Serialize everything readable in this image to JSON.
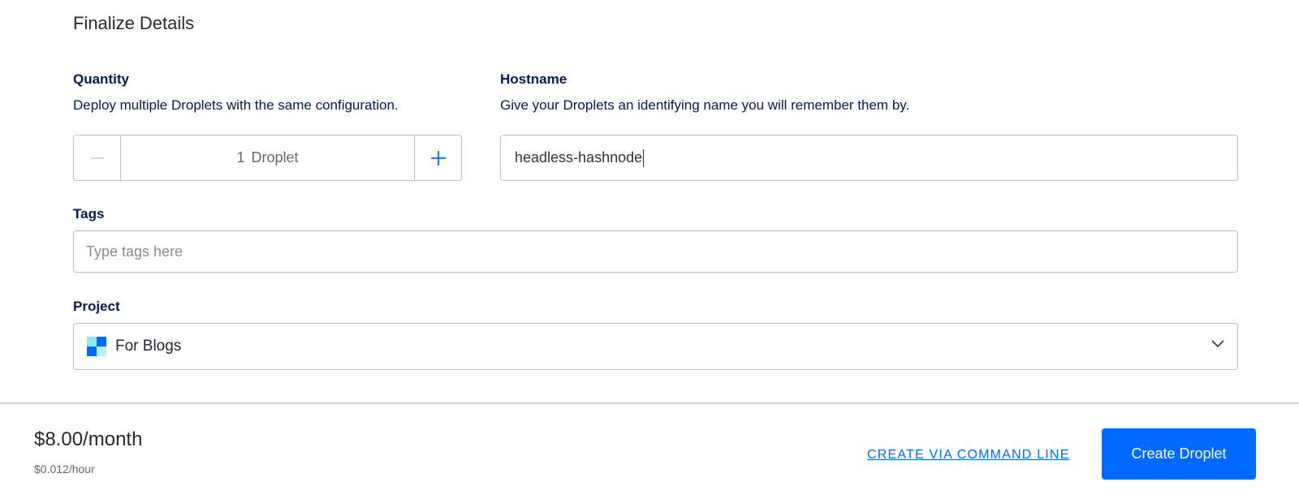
{
  "section": {
    "title": "Finalize Details"
  },
  "quantity": {
    "label": "Quantity",
    "description": "Deploy multiple Droplets with the same configuration.",
    "value": "1",
    "unit": "Droplet"
  },
  "hostname": {
    "label": "Hostname",
    "description": "Give your Droplets an identifying name you will remember them by.",
    "value": "headless-hashnode"
  },
  "tags": {
    "label": "Tags",
    "placeholder": "Type tags here"
  },
  "project": {
    "label": "Project",
    "selected": "For Blogs"
  },
  "footer": {
    "price": "$8.00/month",
    "price_hour": "$0.012/hour",
    "cli_link": "CREATE VIA COMMAND LINE",
    "create_button": "Create Droplet"
  },
  "colors": {
    "accent": "#0069ff",
    "text_dark": "#031b4e",
    "border": "#bfbfbf"
  },
  "icons": {
    "minus": "minus-icon",
    "plus": "plus-icon",
    "project": "project-icon",
    "dropdown": "chevron-down-icon"
  }
}
